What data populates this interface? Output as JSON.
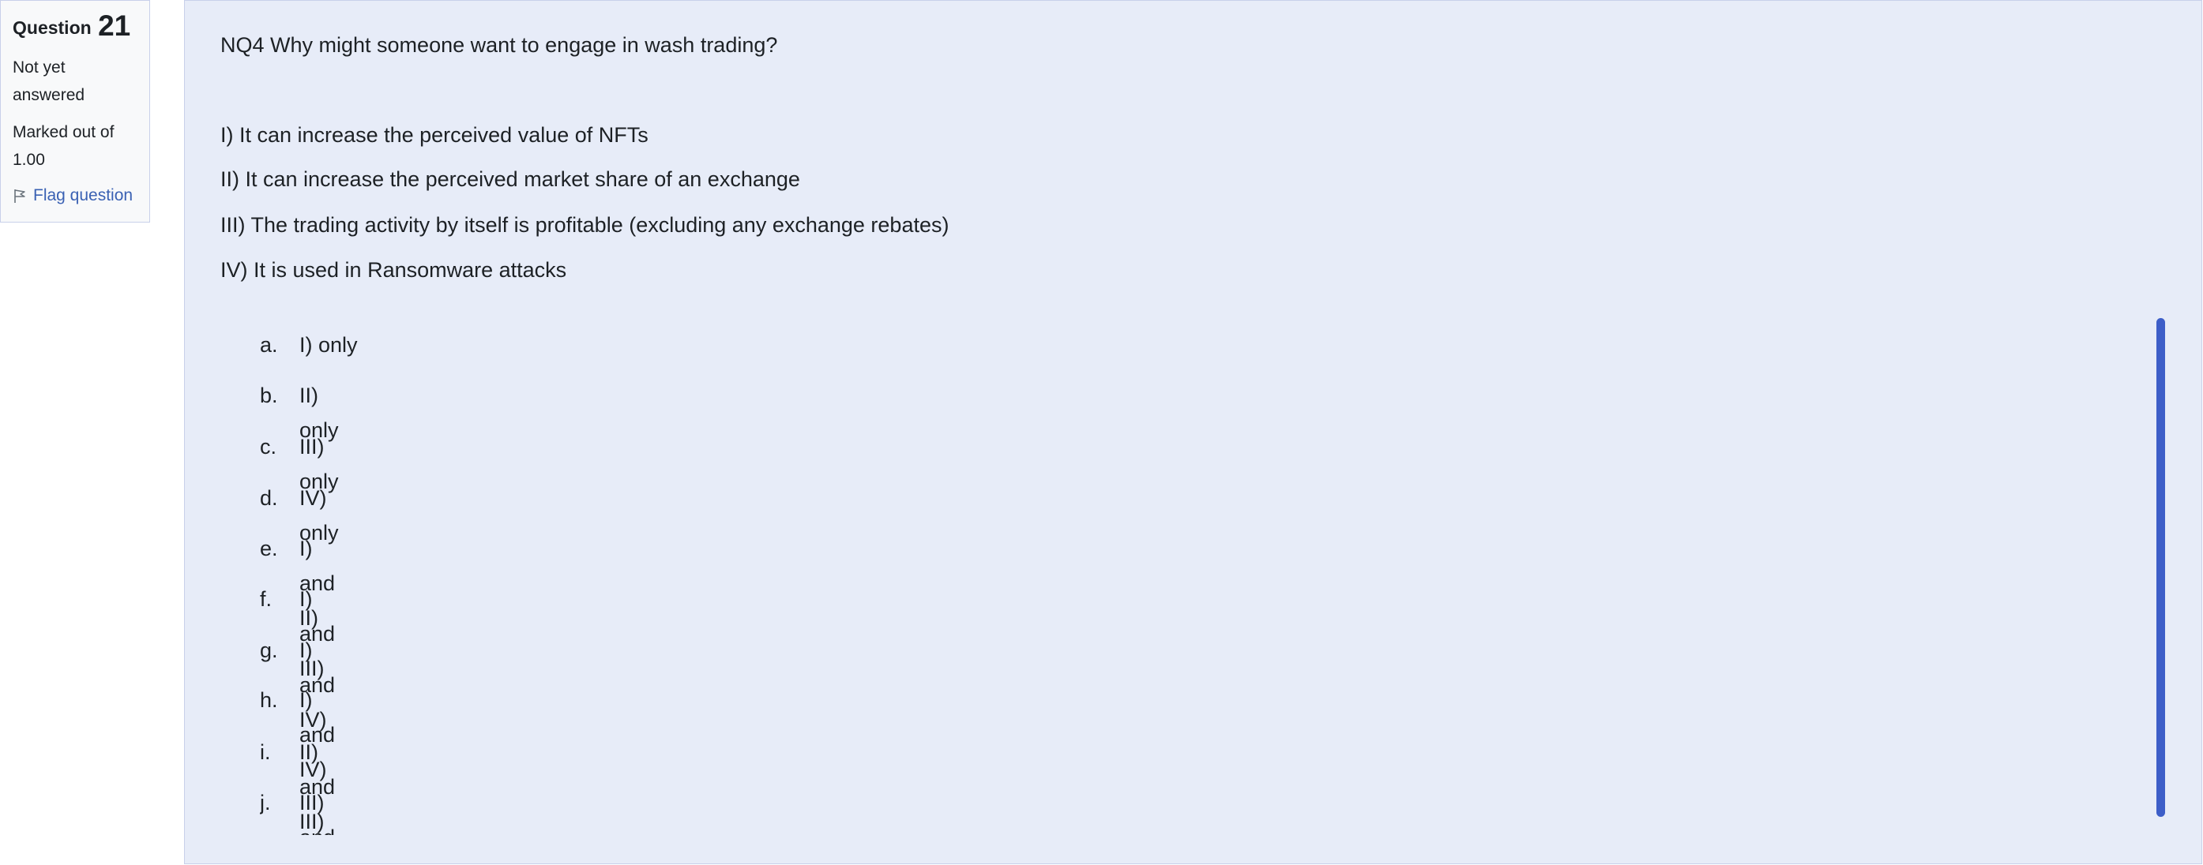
{
  "info": {
    "question_label": "Question",
    "question_number": "21",
    "state": "Not yet answered",
    "grade": "Marked out of 1.00",
    "flag_label": "Flag question"
  },
  "question": {
    "text": "NQ4 Why might someone want to engage in wash trading?",
    "statements": [
      "I) It can increase the perceived value of NFTs",
      "II) It can increase the perceived market share of an exchange",
      "III) The trading activity by itself is profitable (excluding any exchange rebates)",
      "IV) It is used in Ransomware attacks"
    ],
    "options": [
      {
        "letter": "a.",
        "label": "I) only"
      },
      {
        "letter": "b.",
        "label": "II) only"
      },
      {
        "letter": "c.",
        "label": "III) only"
      },
      {
        "letter": "d.",
        "label": "IV) only"
      },
      {
        "letter": "e.",
        "label": "I) and II)"
      },
      {
        "letter": "f.",
        "label": "I) and III)"
      },
      {
        "letter": "g.",
        "label": "I) and IV)"
      },
      {
        "letter": "h.",
        "label": "I) and IV)"
      },
      {
        "letter": "i.",
        "label": "II) and III)"
      },
      {
        "letter": "j.",
        "label": "III) and IV)"
      }
    ]
  },
  "colors": {
    "accent": "#3d5ec8",
    "panel_background": "#e7ecf8",
    "link": "#3a61b3"
  }
}
